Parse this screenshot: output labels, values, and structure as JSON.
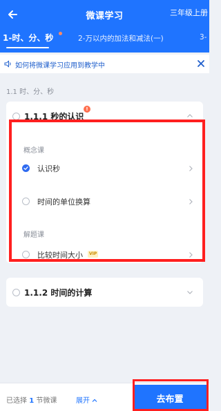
{
  "header": {
    "title": "微课学习",
    "grade": "三年级上册",
    "tabs": [
      {
        "label": "1-时、分、秒",
        "active": true
      },
      {
        "label": "2-万以内的加法和减法(一)",
        "active": false
      },
      {
        "label": "3-",
        "active": false
      }
    ]
  },
  "notice": {
    "text": "如何将微课学习应用到教学中"
  },
  "section_title": "1.1 时、分、秒",
  "lessons": [
    {
      "title": "1.1.1 秒的认识",
      "badge": "!",
      "groups": [
        {
          "label": "概念课",
          "items": [
            {
              "label": "认识秒",
              "checked": true
            },
            {
              "label": "时间的单位换算",
              "checked": false
            }
          ]
        },
        {
          "label": "解题课",
          "items": [
            {
              "label": "比较时间大小",
              "checked": false,
              "vip": "VIP"
            }
          ]
        }
      ]
    },
    {
      "title": "1.1.2 时间的计算"
    }
  ],
  "footer": {
    "selected_prefix": "已选择",
    "selected_count": "1",
    "selected_suffix": "节微课",
    "expand_label": "展开",
    "assign_label": "去布置"
  },
  "colors": {
    "primary": "#1f74ff",
    "highlight": "#ff1f1f",
    "badge": "#ff6f4e"
  }
}
